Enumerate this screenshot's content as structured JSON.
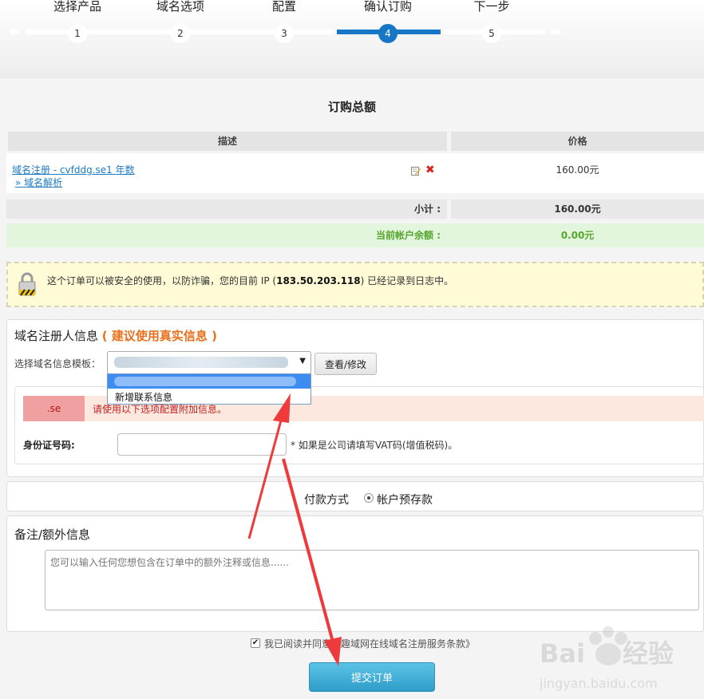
{
  "steps": [
    {
      "label": "选择产品",
      "num": "1"
    },
    {
      "label": "域名选项",
      "num": "2"
    },
    {
      "label": "配置",
      "num": "3"
    },
    {
      "label": "确认订购",
      "num": "4"
    },
    {
      "label": "下一步",
      "num": "5"
    }
  ],
  "summary": {
    "title": "订购总额",
    "col_desc": "描述",
    "col_price": "价格",
    "item_name": "域名注册 - cvfddg.se1 年数",
    "item_sub": "» 域名解析",
    "item_price": "160.00元",
    "subtotal_label": "小计 :",
    "subtotal_value": "160.00元",
    "balance_label": "当前帐户余额 :",
    "balance_value": "0.00元"
  },
  "notice": {
    "text_before": "这个订单可以被安全的使用，以防诈骗，您的目前 IP (",
    "ip": "183.50.203.118",
    "text_after": ") 已经记录到日志中。"
  },
  "registrant": {
    "title": "域名注册人信息",
    "title_hint": "( 建议使用真实信息 )",
    "template_label": "选择域名信息模板：",
    "select_arrow": "▼",
    "dropdown_option": "新增联系信息",
    "view_button": "查看/修改",
    "tld_tag": ".se",
    "tld_hint": "请使用以下选项配置附加信息。",
    "id_label": "身份证号码:",
    "id_hint": "* 如果是公司请填写VAT码(增值税码)。"
  },
  "payment": {
    "label": "付款方式",
    "option": "帐户预存款"
  },
  "notes": {
    "title": "备注/额外信息",
    "placeholder": "您可以输入任何您想包含在订单中的额外注释或信息......"
  },
  "agree": {
    "text": "我已阅读并同意《趣域网在线域名注册服务条款》"
  },
  "submit_label": "提交订单",
  "colors": {
    "accent": "#1577c6",
    "link": "#1c7bc4",
    "warning": "#e8701c",
    "success": "#57a52f",
    "annotation_arrow": "#ee3a3a"
  }
}
